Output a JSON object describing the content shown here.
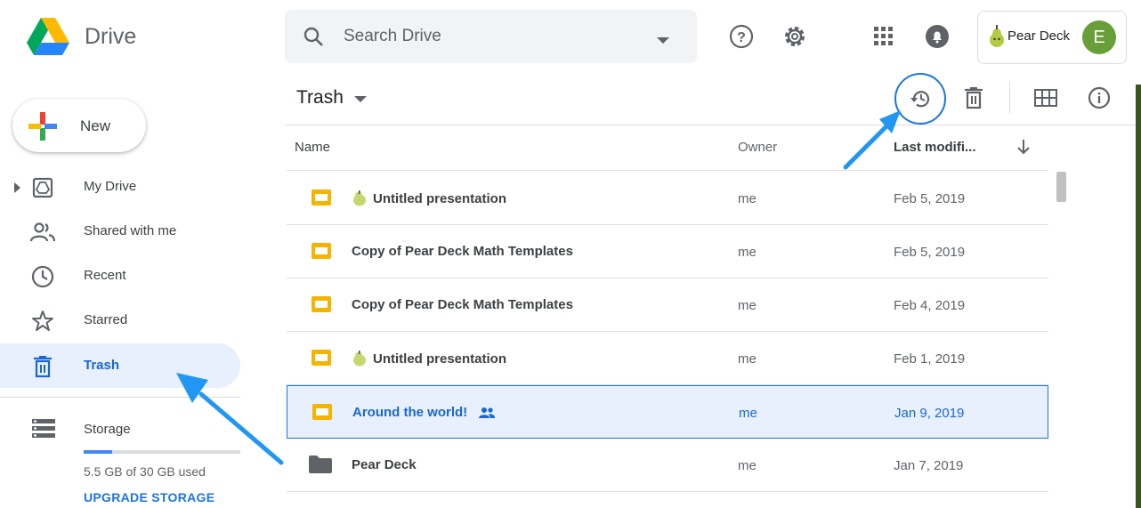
{
  "app": {
    "name": "Drive"
  },
  "search": {
    "placeholder": "Search Drive"
  },
  "account": {
    "addon_label": "Pear Deck",
    "avatar_letter": "E",
    "avatar_color": "#689f38"
  },
  "sidebar": {
    "new_label": "New",
    "items": [
      {
        "label": "My Drive",
        "icon": "my-drive-icon"
      },
      {
        "label": "Shared with me",
        "icon": "people-icon"
      },
      {
        "label": "Recent",
        "icon": "clock-icon"
      },
      {
        "label": "Starred",
        "icon": "star-icon"
      },
      {
        "label": "Trash",
        "icon": "trash-icon",
        "active": true
      }
    ],
    "storage": {
      "label": "Storage",
      "used_text": "5.5 GB of 30 GB used",
      "used_fraction": 0.18,
      "upgrade_label": "UPGRADE STORAGE"
    }
  },
  "main": {
    "title": "Trash",
    "columns": {
      "name": "Name",
      "owner": "Owner",
      "modified": "Last modifi..."
    },
    "rows": [
      {
        "name": "Untitled presentation",
        "owner": "me",
        "date": "Feb 5, 2019",
        "type": "slides",
        "pear": true
      },
      {
        "name": "Copy of Pear Deck Math Templates",
        "owner": "me",
        "date": "Feb 5, 2019",
        "type": "slides"
      },
      {
        "name": "Copy of Pear Deck Math Templates",
        "owner": "me",
        "date": "Feb 4, 2019",
        "type": "slides"
      },
      {
        "name": "Untitled presentation",
        "owner": "me",
        "date": "Feb 1, 2019",
        "type": "slides",
        "pear": true
      },
      {
        "name": "Around the world!",
        "owner": "me",
        "date": "Jan 9, 2019",
        "type": "slides",
        "shared": true,
        "selected": true
      },
      {
        "name": "Pear Deck",
        "owner": "me",
        "date": "Jan 7, 2019",
        "type": "folder"
      }
    ]
  },
  "colors": {
    "accent": "#1a73e8",
    "slides_yellow": "#f4b400",
    "annotation_arrow": "#2196f3"
  }
}
